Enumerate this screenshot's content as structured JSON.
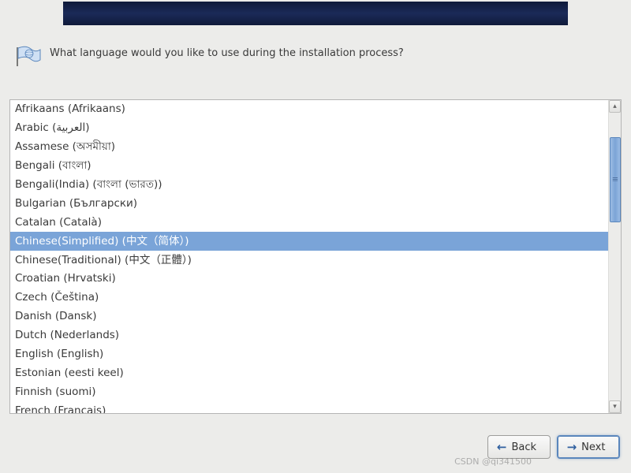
{
  "header": {
    "question": "What language would you like to use during the installation process?"
  },
  "icons": {
    "banner": "installer-banner",
    "flag": "language-flag-icon",
    "back": "←",
    "next": "→"
  },
  "languages": {
    "selected_index": 7,
    "items": [
      "Afrikaans (Afrikaans)",
      "Arabic (العربية)",
      "Assamese (অসমীয়া)",
      "Bengali (বাংলা)",
      "Bengali(India) (বাংলা (ভারত))",
      "Bulgarian (Български)",
      "Catalan (Català)",
      "Chinese(Simplified) (中文（简体）)",
      "Chinese(Traditional) (中文（正體）)",
      "Croatian (Hrvatski)",
      "Czech (Čeština)",
      "Danish (Dansk)",
      "Dutch (Nederlands)",
      "English (English)",
      "Estonian (eesti keel)",
      "Finnish (suomi)",
      "French (Français)"
    ]
  },
  "buttons": {
    "back": "Back",
    "next": "Next"
  },
  "watermark": "CSDN @qi341500"
}
